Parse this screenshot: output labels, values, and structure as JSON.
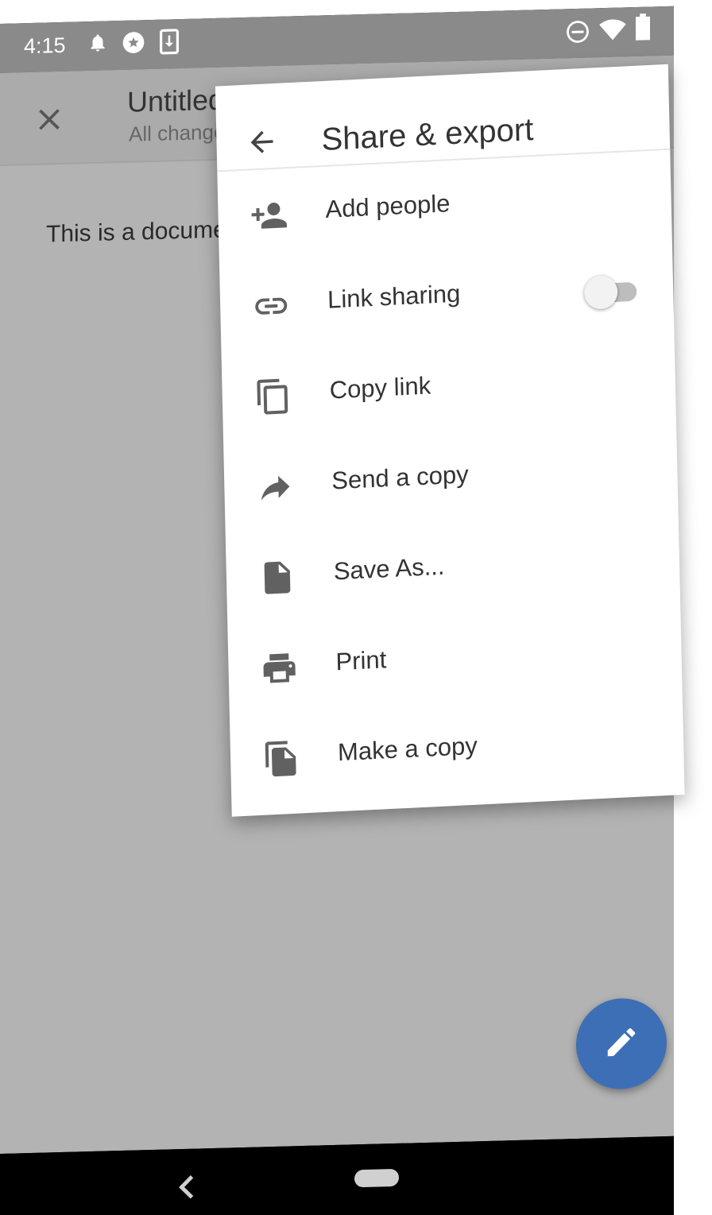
{
  "status_bar": {
    "time": "4:15",
    "left_icons": [
      "bell-icon",
      "circle-star-icon",
      "download-icon"
    ],
    "right_icons": [
      "dnd-icon",
      "wifi-icon",
      "battery-icon"
    ]
  },
  "app_bar": {
    "title": "Untitled",
    "subtitle": "All changes saved"
  },
  "document": {
    "body_text": "This is a document"
  },
  "share_menu": {
    "title": "Share & export",
    "items": [
      {
        "label": "Add people",
        "icon": "person-add-icon"
      },
      {
        "label": "Link sharing",
        "icon": "link-icon",
        "toggle_on": false
      },
      {
        "label": "Copy link",
        "icon": "copy-icon"
      },
      {
        "label": "Send a copy",
        "icon": "share-arrow-icon"
      },
      {
        "label": "Save As...",
        "icon": "file-icon"
      },
      {
        "label": "Print",
        "icon": "print-icon"
      },
      {
        "label": "Make a copy",
        "icon": "file-copy-icon"
      }
    ]
  },
  "colors": {
    "fab": "#3d6fb6",
    "scrim": "#b3b3b3",
    "menu_bg": "#ffffff",
    "icon": "#616161"
  }
}
